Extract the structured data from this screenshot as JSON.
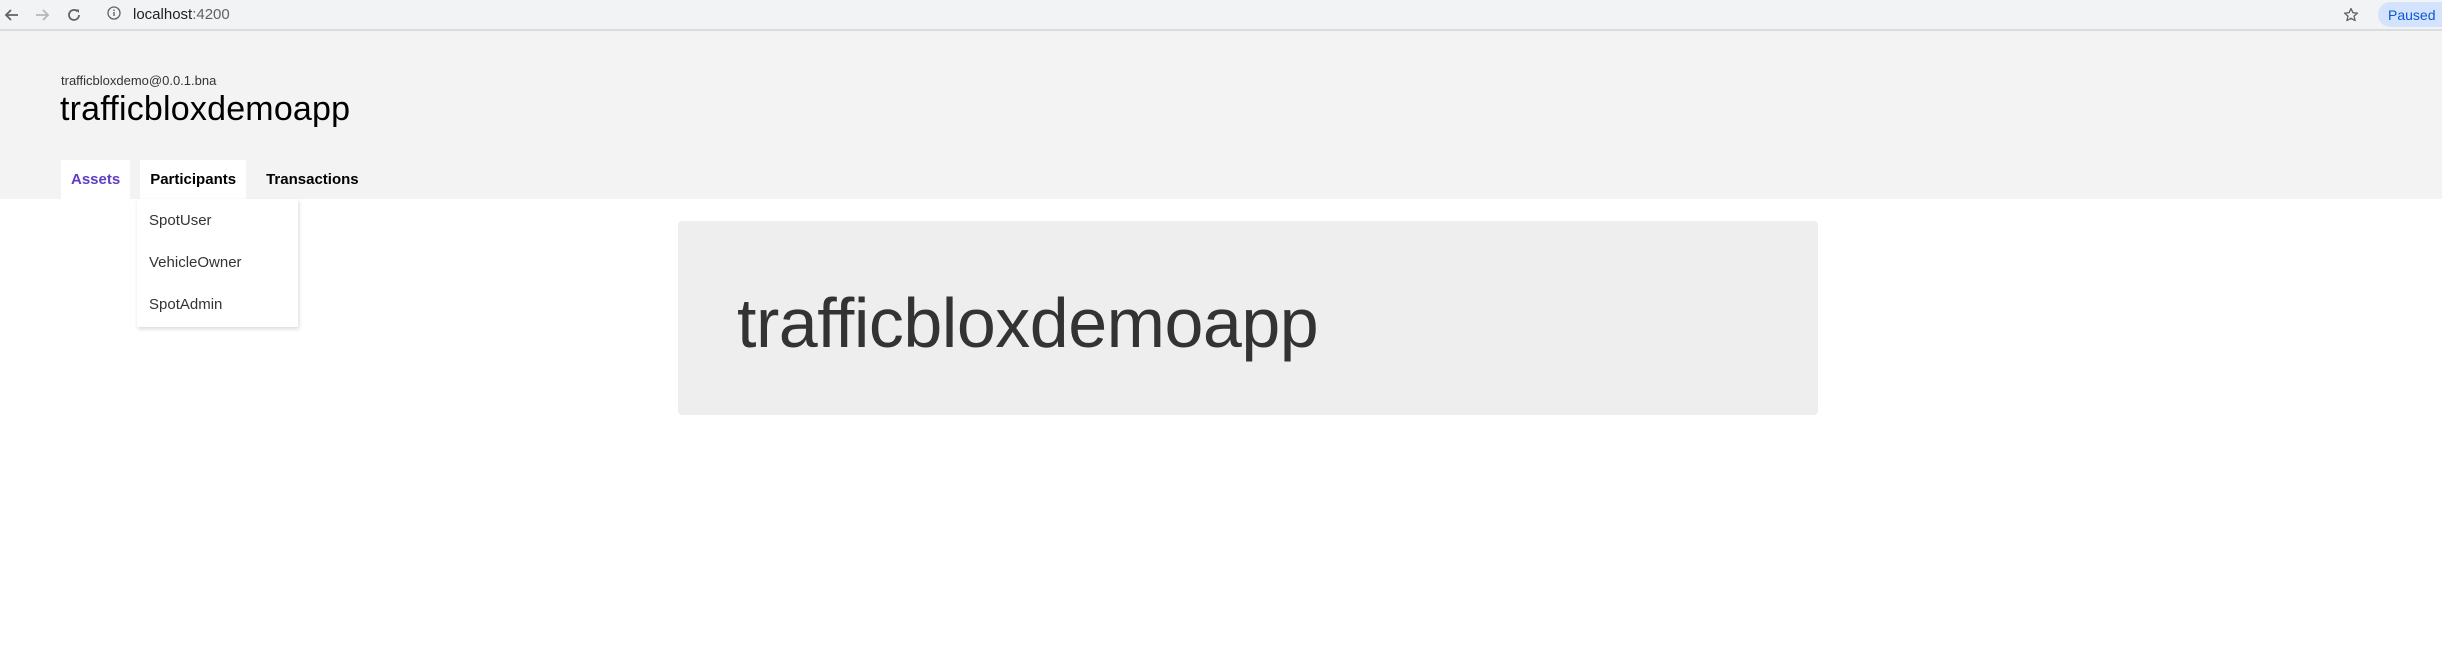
{
  "browser": {
    "url_host": "localhost",
    "url_port": ":4200",
    "paused_label": "Paused",
    "icons": [
      "back-arrow-icon",
      "forward-arrow-icon",
      "reload-icon",
      "info-icon",
      "star-icon"
    ]
  },
  "header": {
    "bna": "trafficbloxdemo@0.0.1.bna",
    "title": "trafficbloxdemoapp"
  },
  "tabs": [
    {
      "label": "Assets"
    },
    {
      "label": "Participants"
    },
    {
      "label": "Transactions"
    }
  ],
  "dropdown": {
    "items": [
      {
        "label": "SpotUser"
      },
      {
        "label": "VehicleOwner"
      },
      {
        "label": "SpotAdmin"
      }
    ]
  },
  "hero": {
    "title": "trafficbloxdemoapp"
  },
  "colors": {
    "accent": "#5f3dc4",
    "header_bg": "#f3f3f3",
    "hero_bg": "#eeeeee",
    "paused_bg": "#d3e3fd",
    "paused_text": "#0b57d0"
  }
}
